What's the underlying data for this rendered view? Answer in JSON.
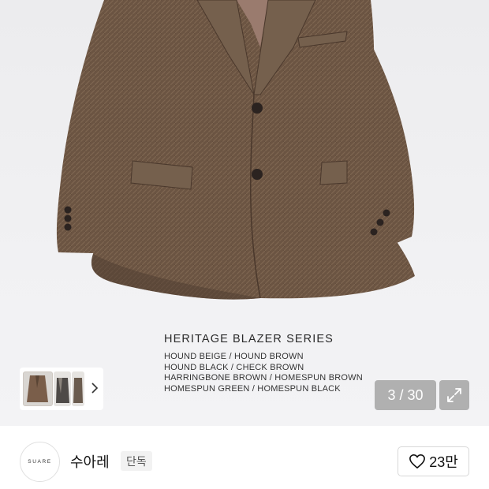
{
  "product_image": {
    "series_title": "HERITAGE BLAZER SERIES",
    "series_lines": [
      "HOUND BEIGE / HOUND BROWN",
      "HOUND BLACK / CHECK BROWN",
      "HARRINGBONE BROWN / HOMESPUN BROWN",
      "HOMESPUN GREEN / HOMESPUN BLACK"
    ]
  },
  "gallery": {
    "counter": "3 / 30",
    "thumbnails_icon": "chevron-right-icon",
    "expand_icon": "expand-icon"
  },
  "shop": {
    "logo_text": "SUARE",
    "name": "수아레",
    "badge": "단독",
    "like_count": "23만",
    "like_icon": "heart-outline-icon"
  },
  "colors": {
    "jacket_brown": "#6b5442",
    "background": "#efeff1",
    "overlay": "#969696"
  }
}
